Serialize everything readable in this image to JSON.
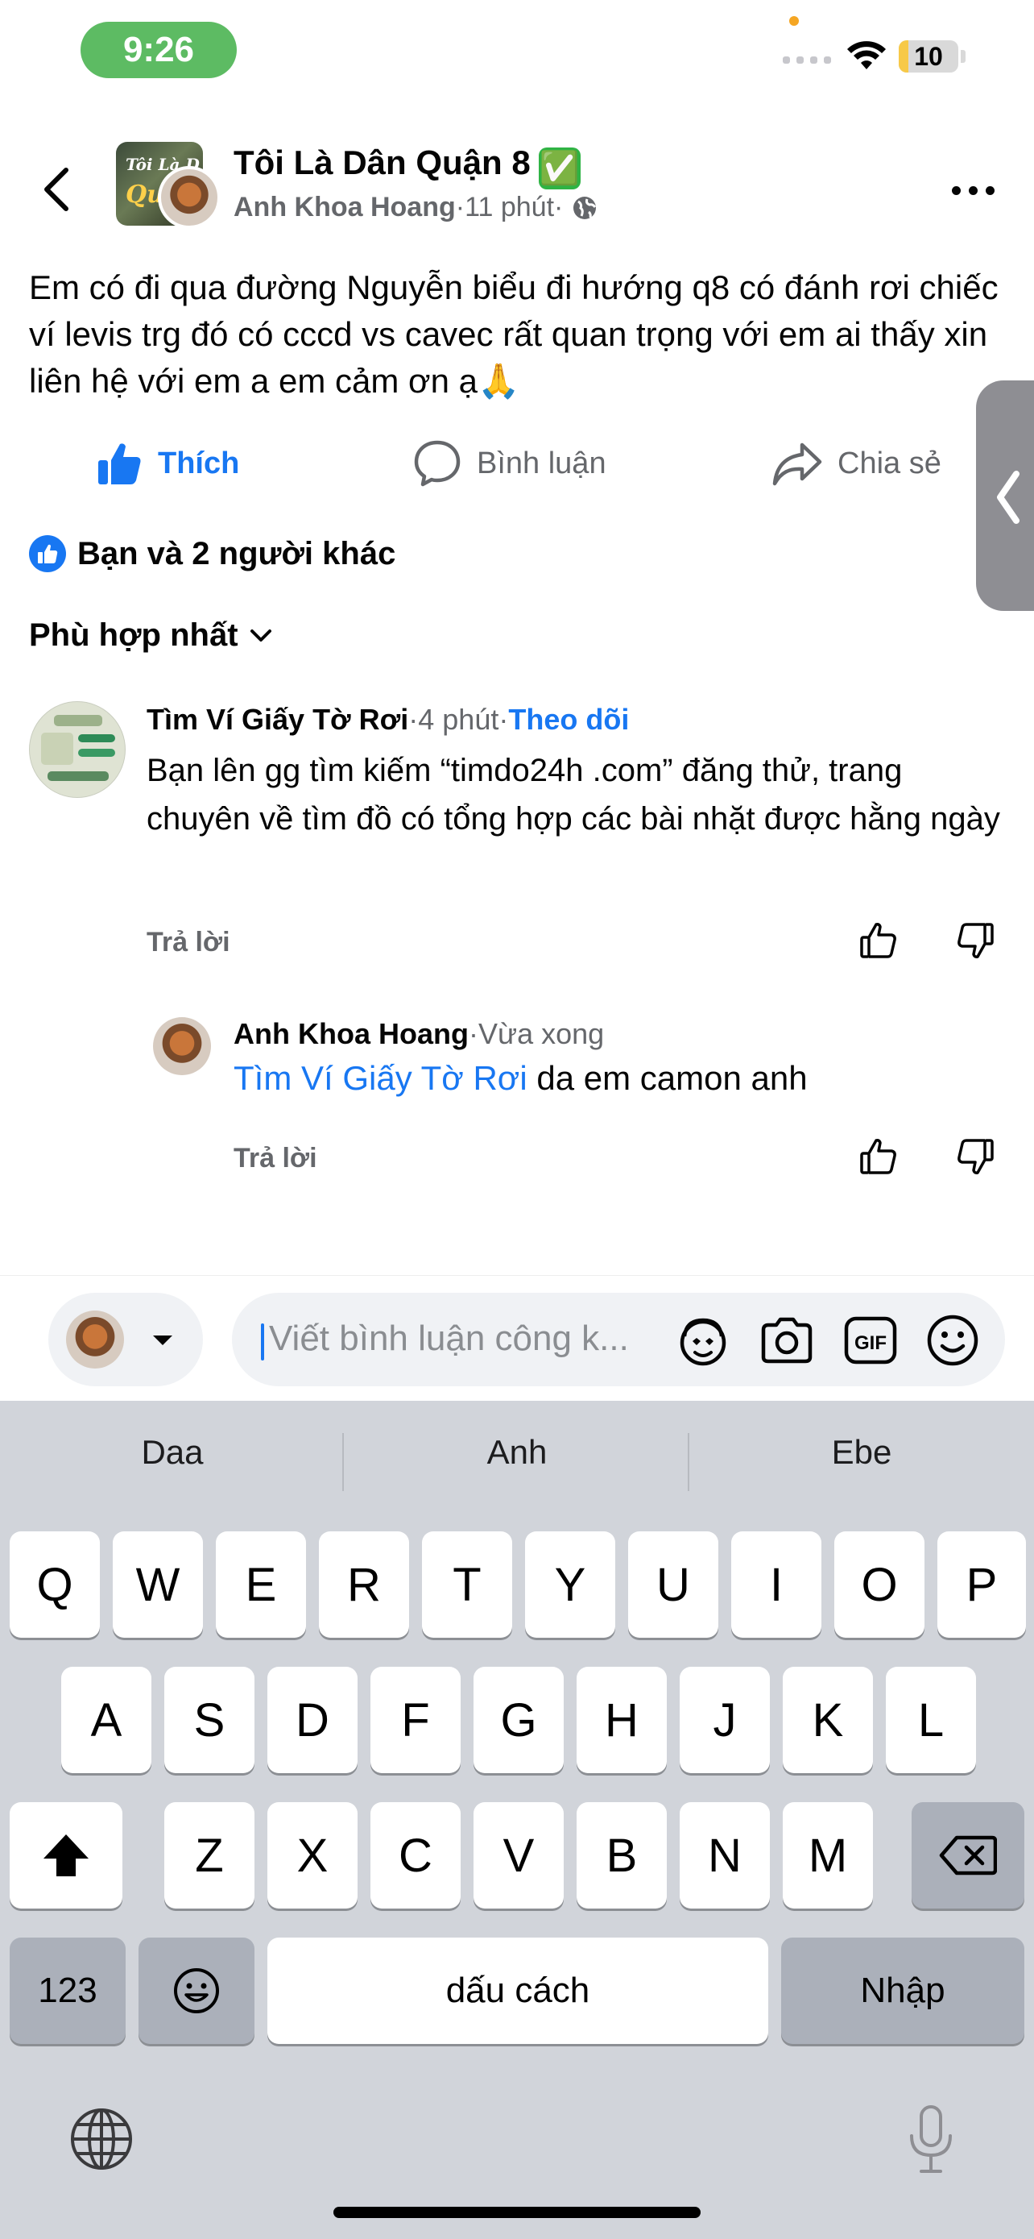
{
  "status_bar": {
    "time": "9:26",
    "battery": "10"
  },
  "header": {
    "group_name": "Tôi Là Dân Quận 8",
    "verified_icon": "✅",
    "avatar_text_1": "Tôi Là D",
    "avatar_text_2": "Quậ",
    "author": "Anh Khoa Hoang",
    "sep1": " · ",
    "time": "11 phút",
    "sep2": " · "
  },
  "post": {
    "text": "Em có đi qua đường Nguyễn biểu đi hướng q8 có đánh rơi chiếc ví levis trg đó có cccd vs cavec rất quan trọng với em ai thấy xin liên hệ với em a em cảm ơn ạ🙏"
  },
  "actions": {
    "like": "Thích",
    "comment": "Bình luận",
    "share": "Chia sẻ"
  },
  "reactions": {
    "summary": "Bạn và 2 người khác"
  },
  "sort": {
    "label": "Phù hợp nhất"
  },
  "comments": [
    {
      "author": "Tìm Ví Giấy Tờ Rơi",
      "sep": " · ",
      "time": "4 phút",
      "sep2": " · ",
      "follow": "Theo dõi",
      "text": "Bạn lên gg tìm kiếm “timdo24h .com” đăng thử, trang chuyên về tìm đồ có tổng hợp các bài nhặt được hằng ngày",
      "reply": "Trả lời"
    },
    {
      "author": "Anh Khoa Hoang",
      "sep": " · ",
      "time": "Vừa xong",
      "mention": "Tìm Ví Giấy Tờ Rơi",
      "text": " da em camon anh",
      "reply": "Trả lời"
    }
  ],
  "composer": {
    "placeholder": "Viết bình luận công k..."
  },
  "keyboard": {
    "suggestions": [
      "Daa",
      "Anh",
      "Ebe"
    ],
    "row1": [
      "Q",
      "W",
      "E",
      "R",
      "T",
      "Y",
      "U",
      "I",
      "O",
      "P"
    ],
    "row2": [
      "A",
      "S",
      "D",
      "F",
      "G",
      "H",
      "J",
      "K",
      "L"
    ],
    "row3": [
      "Z",
      "X",
      "C",
      "V",
      "B",
      "N",
      "M"
    ],
    "numbers": "123",
    "space": "dấu cách",
    "return": "Nhập"
  },
  "icons": {
    "back": "chevron-left-icon",
    "more": "more-horizontal-icon",
    "globe": "globe-icon",
    "like": "thumbs-up-icon",
    "comment": "comment-bubble-icon",
    "share": "share-arrow-icon",
    "camera": "camera-icon",
    "gif": "gif-icon",
    "emoji": "smiley-icon",
    "avatar_sticker": "avatar-sticker-icon",
    "shift": "shift-icon",
    "delete": "backspace-icon",
    "emoji_key": "emoji-icon",
    "globe_key": "globe-icon",
    "mic": "microphone-icon"
  },
  "colors": {
    "accent": "#1877f2",
    "time_pill": "#5dbb63",
    "keyboard_bg": "#d1d4da"
  }
}
